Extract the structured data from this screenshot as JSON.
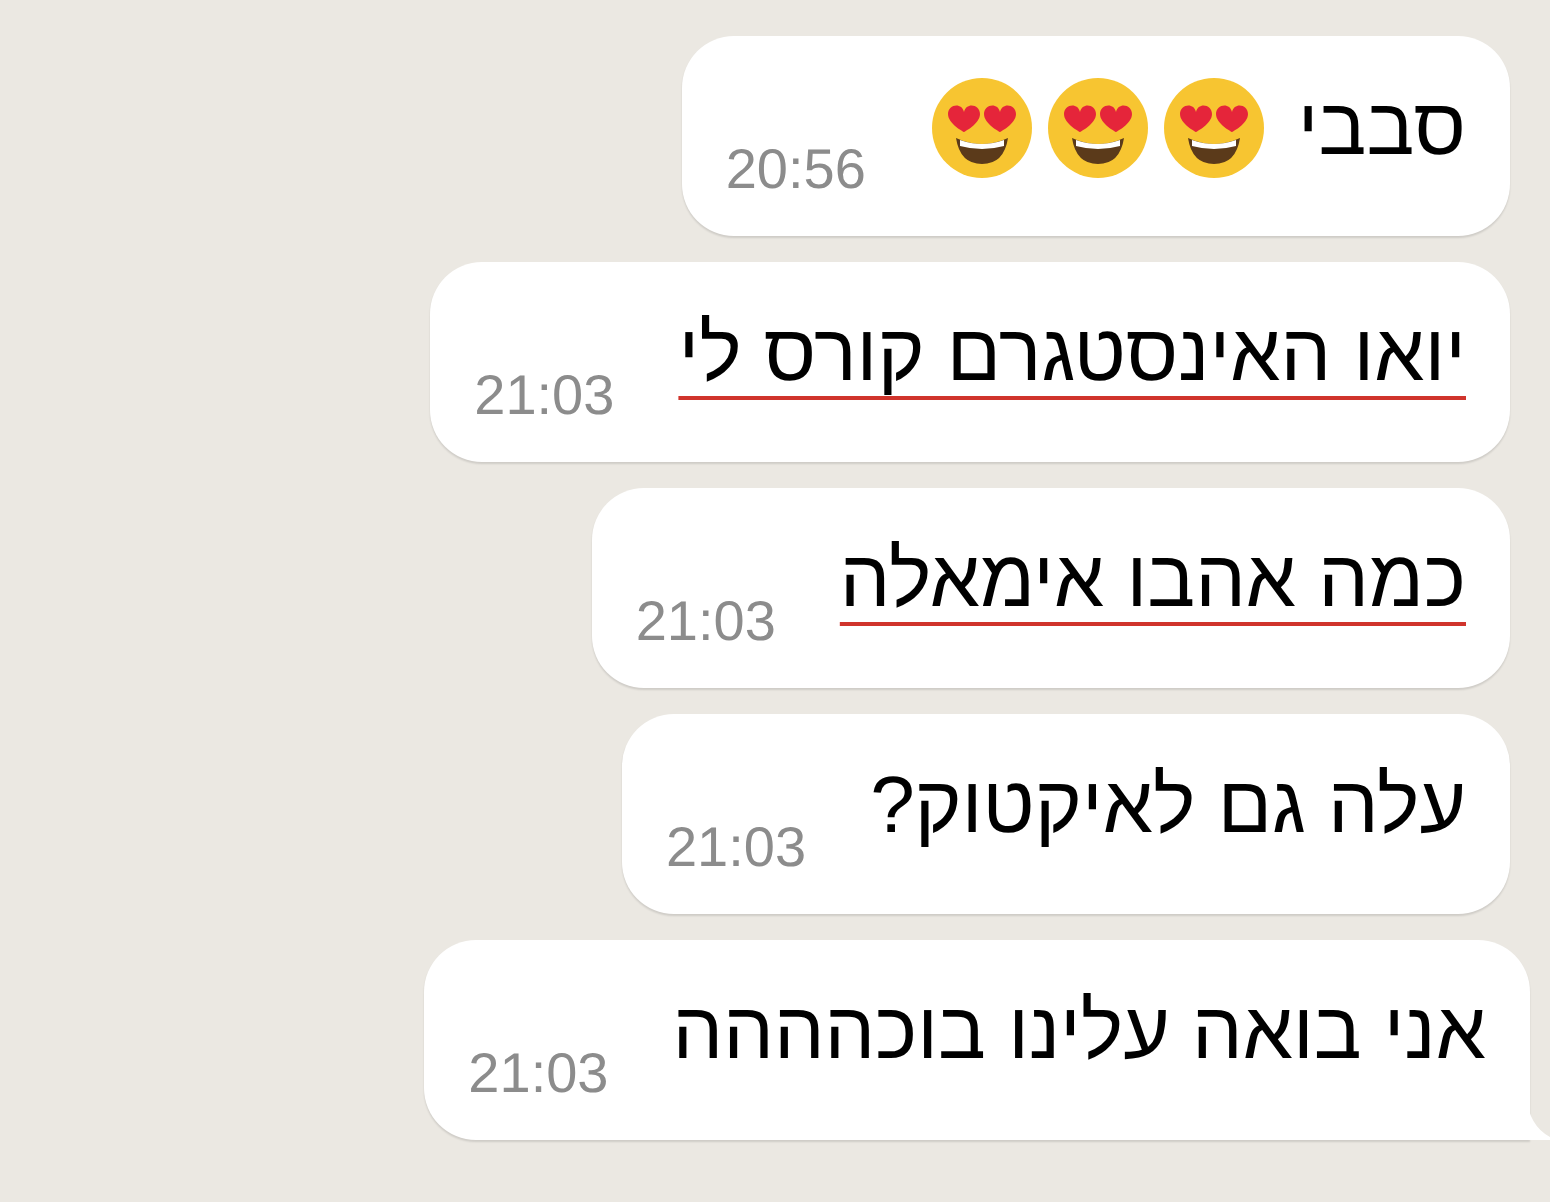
{
  "messages": [
    {
      "text": "סבבי",
      "emojis": [
        {
          "kind": "heart_eyes"
        },
        {
          "kind": "heart_eyes"
        },
        {
          "kind": "heart_eyes"
        }
      ],
      "time": "20:56",
      "spell_error": false,
      "tail": false
    },
    {
      "text": "יואו האינסטגרם קורס לי",
      "time": "21:03",
      "spell_error": true,
      "tail": false
    },
    {
      "text": "כמה אהבו אימאלה",
      "time": "21:03",
      "spell_error": true,
      "tail": false
    },
    {
      "text": "עלה גם לאיקטוק?",
      "time": "21:03",
      "spell_error": false,
      "tail": false
    },
    {
      "text": "אני בואה עלינו בוכהההה",
      "time": "21:03",
      "spell_error": false,
      "tail": true
    }
  ]
}
